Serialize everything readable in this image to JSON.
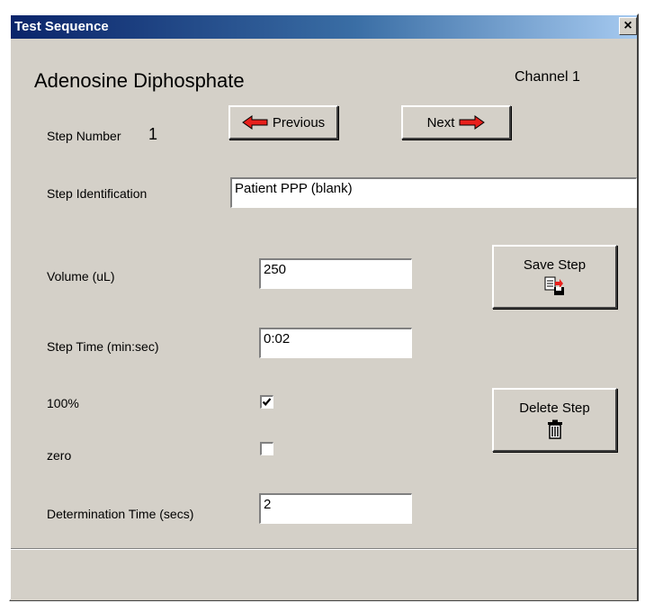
{
  "window": {
    "title": "Test Sequence",
    "close_label": "×"
  },
  "header": {
    "test_name": "Adenosine Diphosphate",
    "channel": "Channel 1"
  },
  "step": {
    "number_label": "Step Number",
    "number": "1",
    "previous_label": "Previous",
    "next_label": "Next",
    "identification_label": "Step Identification",
    "identification_value": "Patient PPP (blank)"
  },
  "fields": {
    "volume_label": "Volume (uL)",
    "volume_value": "250",
    "step_time_label": "Step Time (min:sec)",
    "step_time_value": "0:02",
    "percent100_label": "100%",
    "percent100_checked": true,
    "zero_label": "zero",
    "zero_checked": false,
    "determination_label": "Determination Time (secs)",
    "determination_value": "2"
  },
  "actions": {
    "save_label": "Save Step",
    "delete_label": "Delete Step"
  },
  "colors": {
    "arrow_red": "#e8201c",
    "title_blue": "#0a246a",
    "face": "#d4d0c8"
  },
  "icons": {
    "previous": "left-arrow-icon",
    "next": "right-arrow-icon",
    "save": "save-disk-icon",
    "delete": "trash-can-icon"
  }
}
